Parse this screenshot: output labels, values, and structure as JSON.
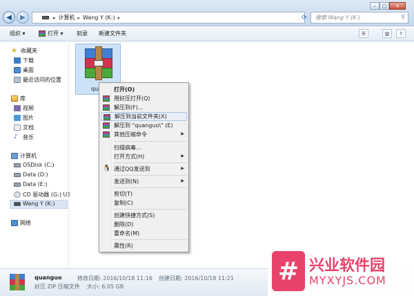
{
  "address_bar": {
    "path": [
      "计算机",
      "Wang Y (K:)"
    ],
    "search_placeholder": "搜索 Wang Y (K:)"
  },
  "toolbar": {
    "organize": "组织 ▾",
    "open": "打开 ▾",
    "burn": "刻录",
    "new_folder": "新建文件夹"
  },
  "sidebar": {
    "favorites": "收藏夹",
    "downloads": "下载",
    "desktop": "桌面",
    "recent": "最近访问的位置",
    "libraries": "库",
    "videos": "视频",
    "pictures": "图片",
    "documents": "文档",
    "music": "音乐",
    "computer": "计算机",
    "drives": [
      "OSDisk (C:)",
      "Data (D:)",
      "Data (E:)",
      "CD 驱动器 (G:) U3",
      "Wang Y (K:)"
    ],
    "network": "网络"
  },
  "file": {
    "name": "quanguo"
  },
  "context_menu": {
    "items": [
      "打开(O)",
      "用好压打开(Q)",
      "解压到(F)...",
      "解压到当前文件夹(X)",
      "解压到 \"quanguo\\\" (E)",
      "其他压缩命令",
      "扫描病毒...",
      "打开方式(H)",
      "通过QQ发送到",
      "发送到(N)",
      "剪切(T)",
      "复制(C)",
      "创建快捷方式(S)",
      "删除(D)",
      "重命名(M)",
      "属性(R)"
    ]
  },
  "status": {
    "name": "quanguo",
    "type": "好压 ZIP 压缩文件",
    "modified": "修改日期: 2016/10/18 11:16",
    "created": "创建日期: 2016/10/18 11:21",
    "size": "大小: 6.05 GB"
  },
  "watermark": {
    "title": "兴业软件园",
    "url": "MYXYJS.COM"
  }
}
